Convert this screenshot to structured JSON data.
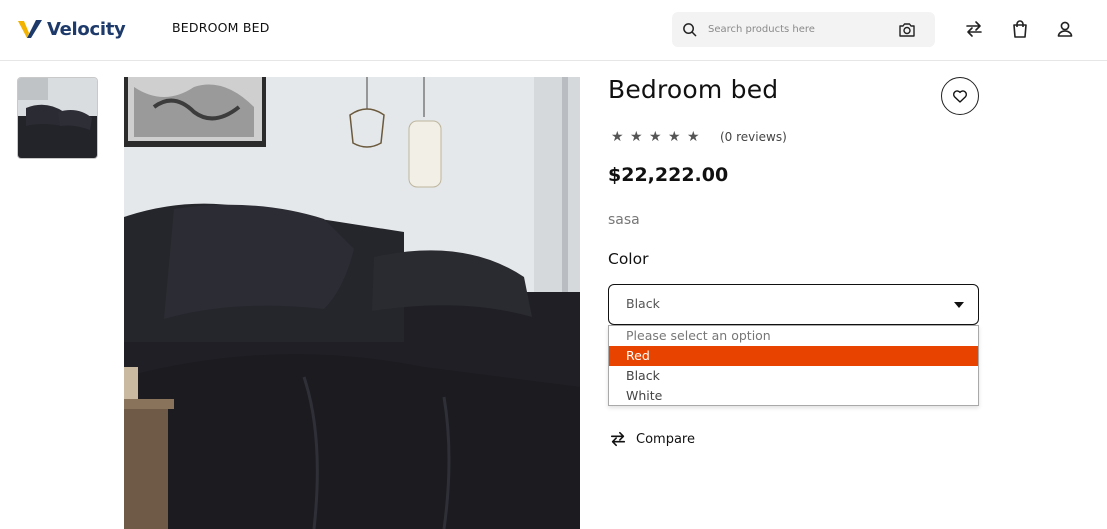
{
  "brand": {
    "name": "Velocity",
    "mark_color": "#f2b400",
    "text_color": "#1d3a6b"
  },
  "header": {
    "breadcrumb": "BEDROOM BED",
    "search": {
      "placeholder": "Search products here"
    },
    "icons": [
      "search-icon",
      "camera-icon",
      "compare-icon",
      "bag-icon",
      "user-icon"
    ]
  },
  "product": {
    "title": "Bedroom bed",
    "rating": {
      "stars": 5,
      "value": 0,
      "reviews_text": "(0 reviews)"
    },
    "price": "$22,222.00",
    "description": "sasa",
    "color_label": "Color",
    "color_select": {
      "value": "Black",
      "options": [
        "Please select an option",
        "Red",
        "Black",
        "White"
      ],
      "highlighted": "Red",
      "highlight_color": "#e84400"
    },
    "compare_label": "Compare"
  },
  "gallery": {
    "thumbnails": 1,
    "selected": 0
  }
}
